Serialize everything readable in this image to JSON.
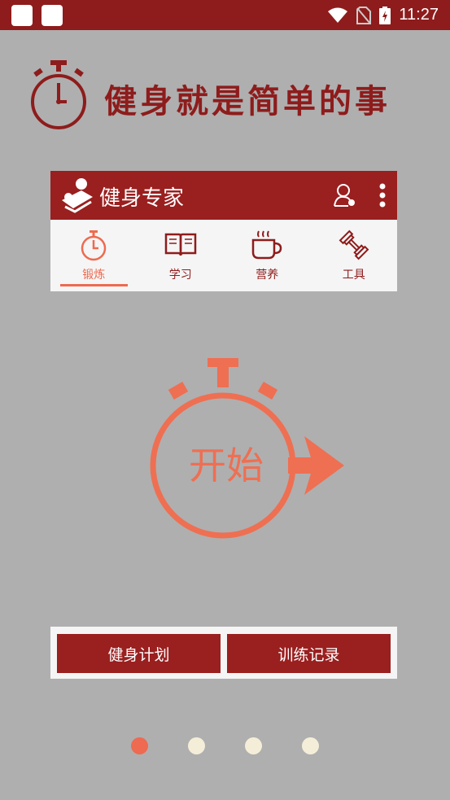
{
  "status_bar": {
    "time": "11:27"
  },
  "hero": {
    "slogan": "健身就是简单的事",
    "icon": "stopwatch-icon"
  },
  "app_card": {
    "title": "健身专家",
    "tabs": [
      {
        "label": "锻炼",
        "icon": "stopwatch-icon",
        "active": true
      },
      {
        "label": "学习",
        "icon": "book-icon",
        "active": false
      },
      {
        "label": "营养",
        "icon": "coffee-cup-icon",
        "active": false
      },
      {
        "label": "工具",
        "icon": "dumbbell-icon",
        "active": false
      }
    ]
  },
  "start_button": {
    "label": "开始"
  },
  "actions": {
    "plan_label": "健身计划",
    "record_label": "训练记录"
  },
  "pager": {
    "count": 4,
    "active_index": 0
  },
  "colors": {
    "brand_red": "#9a1f1f",
    "accent_orange": "#ee6a50",
    "background": "#afafaf"
  }
}
